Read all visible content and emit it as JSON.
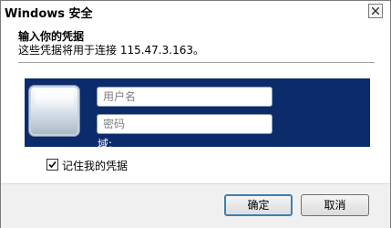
{
  "window": {
    "title": "Windows 安全",
    "close_icon": "close-icon"
  },
  "header": {
    "title": "输入你的凭据",
    "subtitle": "这些凭据将用于连接 115.47.3.163。"
  },
  "credentials": {
    "username_placeholder": "用户名",
    "password_placeholder": "密码",
    "domain_label": "域:",
    "user_tile_icon": "user-tile-icon"
  },
  "remember": {
    "label": "记住我的凭据",
    "checked": true
  },
  "buttons": {
    "ok": "确定",
    "cancel": "取消"
  },
  "colors": {
    "panel": "#0b2b6b",
    "footer": "#f0f0f0"
  }
}
